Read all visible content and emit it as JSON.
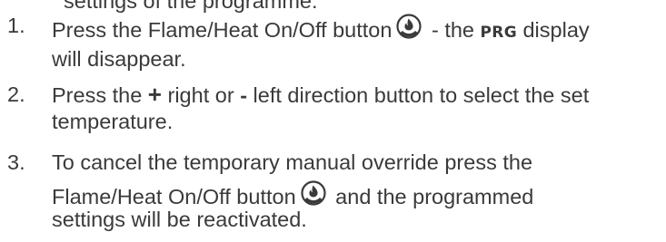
{
  "cut_line": "settings of the programme.",
  "steps": [
    {
      "number": "1.",
      "line1_part1": "Press the Flame/Heat On/Off button",
      "line1_part2": " - the ",
      "prg": "PRG",
      "line1_part3": " display",
      "line2": "will disappear."
    },
    {
      "number": "2.",
      "line1_part1": "Press the ",
      "plus": "+",
      "line1_part2": " right or ",
      "minus": "-",
      "line1_part3": " left direction button to select the set",
      "line2": "temperature."
    },
    {
      "number": "3.",
      "line1": "To cancel the temporary manual override press the",
      "line2_part1": "Flame/Heat On/Off button",
      "line2_part2": " and the programmed",
      "line3": "settings will be reactivated."
    }
  ],
  "icons": {
    "flame_heat_button": "flame-heat-button-icon"
  }
}
